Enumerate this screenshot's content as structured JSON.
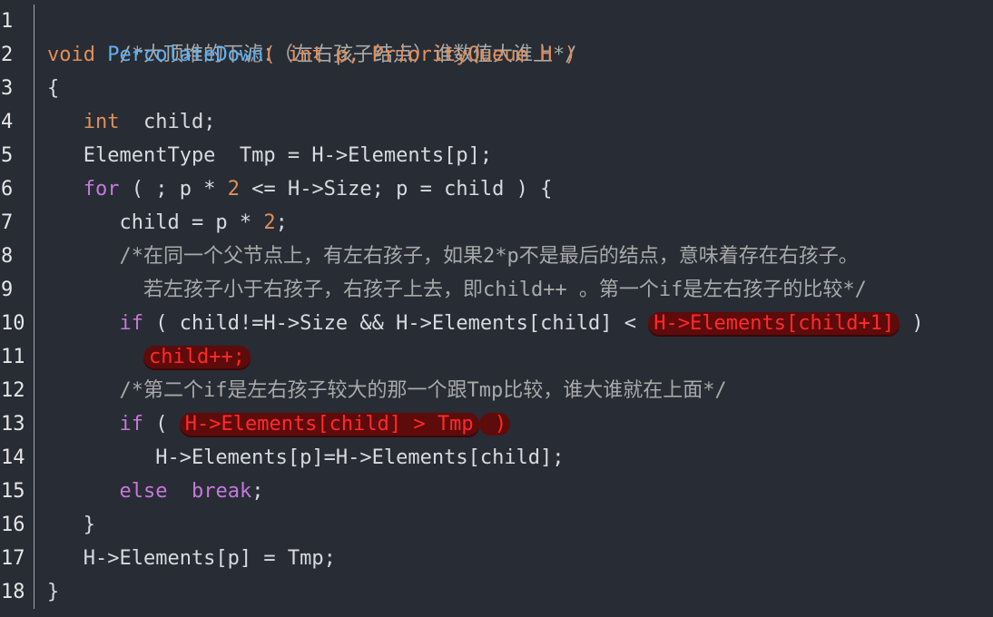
{
  "editor": {
    "lines": [
      {
        "num": "1",
        "segments": [
          {
            "text": "/*大顶堆的下滤：（左右孩子结点）谁数值大谁上*/"
          }
        ]
      },
      {
        "num": "2",
        "segments": [
          {
            "text": "void "
          },
          {
            "text": "PercolateDown"
          },
          {
            "text": "( "
          },
          {
            "text": "int"
          },
          {
            "text": " p, "
          },
          {
            "text": "PriorityQueue"
          },
          {
            "text": " H )"
          }
        ]
      },
      {
        "num": "3",
        "segments": [
          {
            "text": "{"
          }
        ]
      },
      {
        "num": "4",
        "segments": [
          {
            "text": "   "
          },
          {
            "text": "int"
          },
          {
            "text": "  child;"
          }
        ]
      },
      {
        "num": "5",
        "segments": [
          {
            "text": "   ElementType  Tmp = H->Elements[p];"
          }
        ]
      },
      {
        "num": "6",
        "segments": [
          {
            "text": "   "
          },
          {
            "text": "for"
          },
          {
            "text": " ( ; p * "
          },
          {
            "text": "2"
          },
          {
            "text": " <= H->Size; p = child ) {"
          }
        ]
      },
      {
        "num": "7",
        "segments": [
          {
            "text": "      child = p * "
          },
          {
            "text": "2"
          },
          {
            "text": ";"
          }
        ]
      },
      {
        "num": "8",
        "segments": [
          {
            "text": "      /*在同一个父节点上，有左右孩子，如果2*p不是最后的结点，意味着存在右孩子。"
          }
        ]
      },
      {
        "num": "9",
        "segments": [
          {
            "text": "        若左孩子小于右孩子，右孩子上去，即child++ 。第一个if是左右孩子的比较*/"
          }
        ]
      },
      {
        "num": "10",
        "segments": [
          {
            "text": "      "
          },
          {
            "text": "if"
          },
          {
            "text": " ( child!=H->Size && H->Elements[child] < "
          },
          {
            "text": "H->Elements[child+1]"
          },
          {
            "text": " )"
          }
        ]
      },
      {
        "num": "11",
        "segments": [
          {
            "text": "        "
          },
          {
            "text": "child++;"
          }
        ]
      },
      {
        "num": "12",
        "segments": [
          {
            "text": "      /*第二个if是左右孩子较大的那一个跟Tmp比较，谁大谁就在上面*/"
          }
        ]
      },
      {
        "num": "13",
        "segments": [
          {
            "text": "      "
          },
          {
            "text": "if"
          },
          {
            "text": " ( "
          },
          {
            "text": "H->Elements[child] > Tmp"
          },
          {
            "text": " )"
          }
        ]
      },
      {
        "num": "14",
        "segments": [
          {
            "text": "         H->Elements[p]=H->Elements[child];"
          }
        ]
      },
      {
        "num": "15",
        "segments": [
          {
            "text": "      "
          },
          {
            "text": "else"
          },
          {
            "text": "  "
          },
          {
            "text": "break"
          },
          {
            "text": ";"
          }
        ]
      },
      {
        "num": "16",
        "segments": [
          {
            "text": "   }"
          }
        ]
      },
      {
        "num": "17",
        "segments": [
          {
            "text": "   H->Elements[p] = Tmp;"
          }
        ]
      },
      {
        "num": "18",
        "segments": [
          {
            "text": "}"
          }
        ]
      }
    ]
  }
}
